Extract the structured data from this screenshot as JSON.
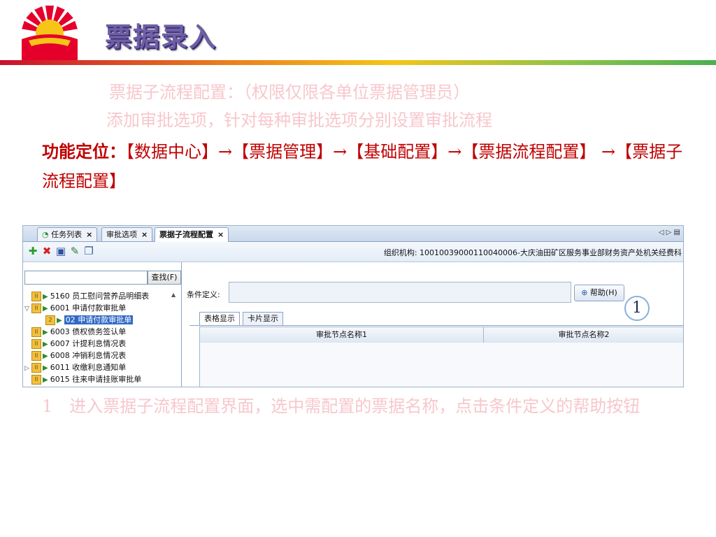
{
  "slide": {
    "title": "票据录入",
    "line1": "票据子流程配置：（权限仅限各单位票据管理员）",
    "line2": "添加审批选项，针对每种审批选项分别设置审批流程",
    "func_label": "功能定位：",
    "func_path": "【数据中心】→【票据管理】→【基础配置】→【票据流程配置】 →【票据子流程配置】",
    "step_desc": "1　进入票据子流程配置界面，选中需配置的票据名称，点击条件定义的帮助按钮"
  },
  "app": {
    "tabs": [
      {
        "label": "任务列表",
        "close": "×"
      },
      {
        "label": "审批选项",
        "close": "×"
      },
      {
        "label": "票据子流程配置",
        "close": "×"
      }
    ],
    "tab_nav": "◁ ▷ ▤",
    "toolbar": {
      "add": "✚",
      "delete": "✖",
      "save": "▣",
      "edit": "✎",
      "copy": "❐"
    },
    "org_label": "组织机构:",
    "org_value": "10010039000110040006-大庆油田矿区服务事业部财务资产处机关经费科",
    "find_button": "查找(F)",
    "tree": [
      {
        "code": "5160",
        "label": "员工慰问营养品明细表",
        "level": 0,
        "expander": ""
      },
      {
        "code": "6001",
        "label": "申请付款审批单",
        "level": 0,
        "expander": "▽"
      },
      {
        "code": "02",
        "label": "申请付款审批单",
        "level": 1,
        "expander": "",
        "selected": true
      },
      {
        "code": "6003",
        "label": "债权债务签认单",
        "level": 0,
        "expander": ""
      },
      {
        "code": "6007",
        "label": "计提利息情况表",
        "level": 0,
        "expander": ""
      },
      {
        "code": "6008",
        "label": "冲销利息情况表",
        "level": 0,
        "expander": ""
      },
      {
        "code": "6011",
        "label": "收缴利息通知单",
        "level": 0,
        "expander": "▷"
      },
      {
        "code": "6015",
        "label": "往来申请挂账审批单",
        "level": 0,
        "expander": ""
      }
    ],
    "condition_label": "条件定义:",
    "help_button": "帮助(H)",
    "step_number": "1",
    "subtabs": [
      "表格显示",
      "卡片显示"
    ],
    "columns": [
      "审批节点名称1",
      "审批节点名称2"
    ]
  },
  "colors": {
    "title": "#6f5fa6",
    "func_text": "#c00000",
    "ghost_text": "#f7c7cc",
    "selection": "#316ac5"
  }
}
